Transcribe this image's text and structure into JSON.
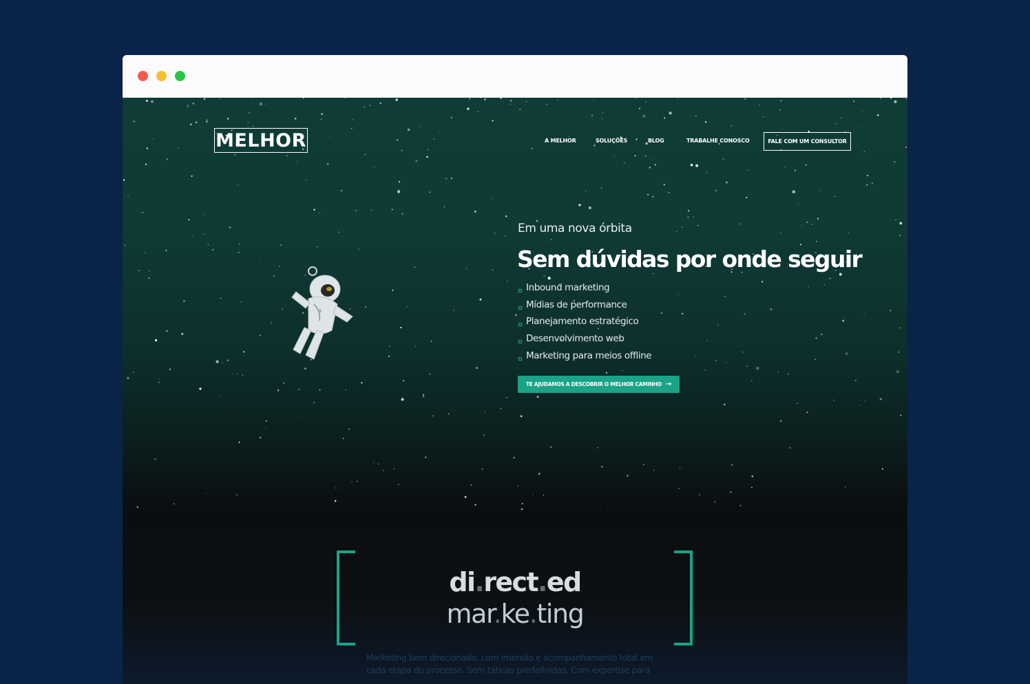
{
  "window": {
    "controls": [
      "close",
      "minimize",
      "maximize"
    ]
  },
  "header": {
    "logo_text": "MELHOR",
    "nav": [
      "A MELHOR",
      "SOLUÇÕES",
      "BLOG",
      "TRABALHE CONOSCO"
    ],
    "cta": "FALE COM UM CONSULTOR"
  },
  "hero": {
    "eyebrow": "Em uma nova órbita",
    "headline": "Sem dúvidas por onde seguir",
    "services": [
      "Inbound marketing",
      "Mídias de performance",
      "Planejamento estratégico",
      "Desenvolvimento web",
      "Marketing para meios offline"
    ],
    "cta": "TE AJUDAMOS A DESCOBRIR O MELHOR CAMINHO",
    "cta_icon": "arrow-right-icon",
    "illustration": "astronaut"
  },
  "brand_section": {
    "line1_parts": [
      "di",
      ".",
      "rect",
      ".",
      "ed"
    ],
    "line2_parts": [
      "mar",
      ".",
      "ke",
      ".",
      "ting"
    ],
    "intro": "Marketing bem direcionado, com imersão e acompanhamento total em cada etapa do processo. Sem táticas predefinidas. Com expertise para"
  },
  "colors": {
    "page_background": "#0a2349",
    "accent": "#1aa387",
    "hero_top": "#0f3c36",
    "hero_dark": "#0b0e10"
  }
}
